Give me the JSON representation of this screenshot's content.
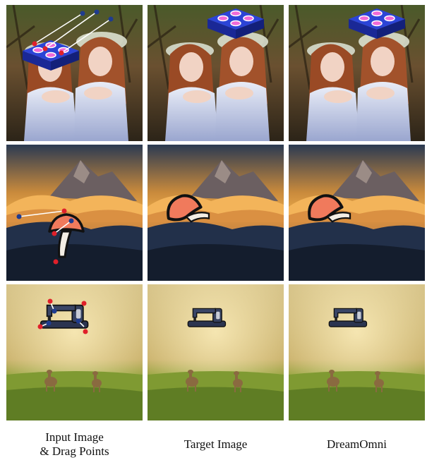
{
  "captions": {
    "input_line1": "Input Image",
    "input_line2": "& Drag Points",
    "target": "Target Image",
    "dreamomni": "DreamOmni"
  },
  "colors": {
    "drag_start": "#e0202a",
    "drag_end": "#1f3c8f",
    "drag_arrow": "#ffffff",
    "mushroom_cap": "#f07a5c",
    "mushroom_stem": "#f3ede4",
    "box_blue": "#1e2fae",
    "box_pink": "#f06ad8"
  },
  "rows": [
    {
      "name": "women-flower-crowns",
      "object": "blue-box-object"
    },
    {
      "name": "mountain-sunset",
      "object": "mushroom-object"
    },
    {
      "name": "deer-meadow",
      "object": "sewing-machine-object"
    }
  ]
}
